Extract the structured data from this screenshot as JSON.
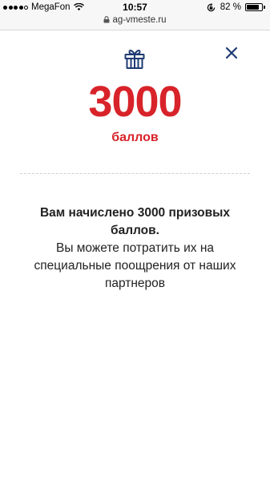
{
  "status_bar": {
    "carrier": "MegaFon",
    "time": "10:57",
    "battery_text": "82 %",
    "battery_level": 0.82,
    "url": "ag-vmeste.ru"
  },
  "modal": {
    "points_value": "3000",
    "points_unit": "баллов",
    "message_bold": "Вам начислено 3000 призовых баллов.",
    "message_regular": "Вы можете потратить их на специальные поощрения от наших партнеров"
  },
  "colors": {
    "accent": "#d8232a",
    "icon": "#1f3b73"
  },
  "icons": {
    "gift": "gift-icon",
    "close": "close-icon"
  }
}
